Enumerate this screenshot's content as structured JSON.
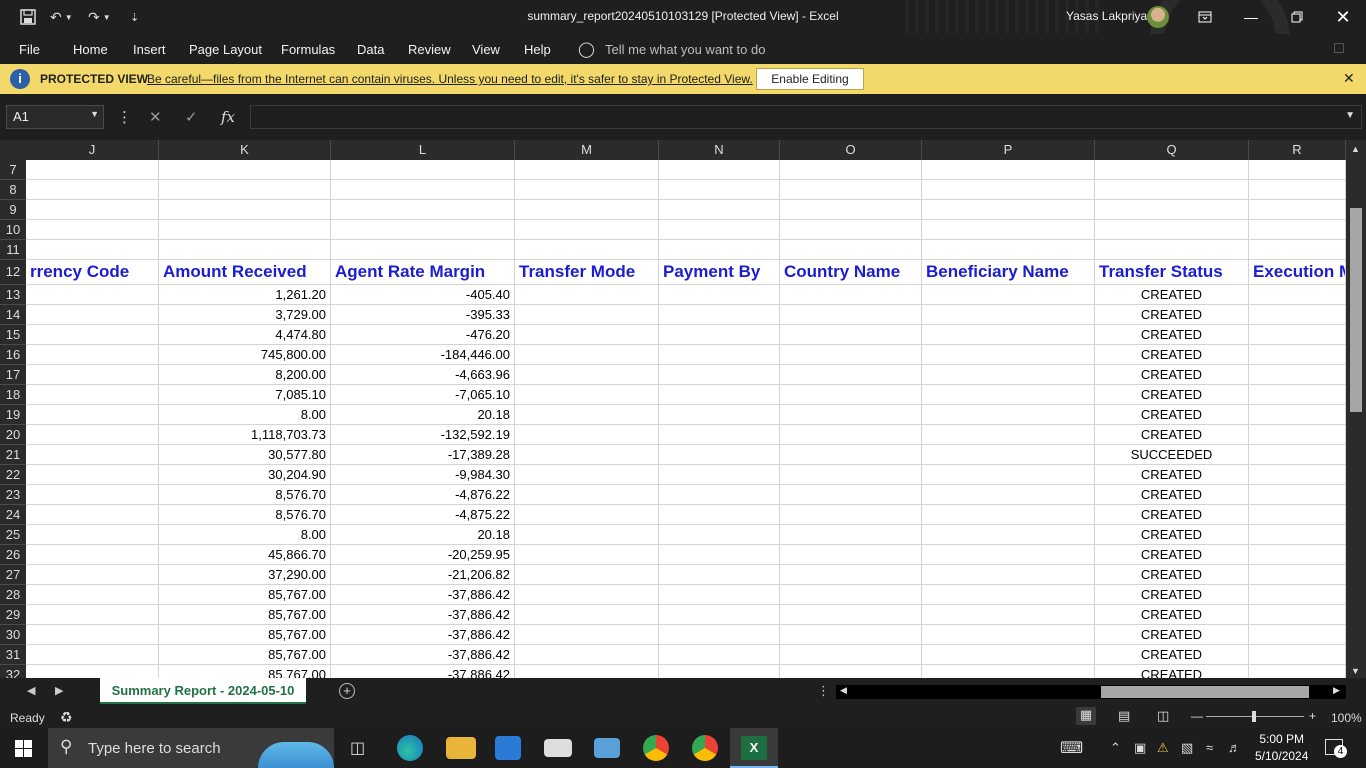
{
  "window": {
    "title": "summary_report20240510103129  [Protected View]  -  Excel",
    "user": "Yasas Lakpriya"
  },
  "menu": [
    "File",
    "Home",
    "Insert",
    "Page Layout",
    "Formulas",
    "Data",
    "Review",
    "View",
    "Help"
  ],
  "tell_me": "Tell me what you want to do",
  "protected_view": {
    "label": "PROTECTED VIEW",
    "message": "Be careful—files from the Internet can contain viruses. Unless you need to edit, it's safer to stay in Protected View.",
    "button": "Enable Editing"
  },
  "formula_bar": {
    "name_box": "A1",
    "value": ""
  },
  "columns": [
    "J",
    "K",
    "L",
    "M",
    "N",
    "O",
    "P",
    "Q",
    "R"
  ],
  "empty_rows": [
    "7",
    "8",
    "9",
    "10",
    "11"
  ],
  "header_row": {
    "num": "12",
    "cells": [
      "rrency Code",
      "Amount Received",
      "Agent Rate Margin",
      "Transfer Mode",
      "Payment By",
      "Country Name",
      "Beneficiary Name",
      "Transfer Status",
      "Execution M"
    ]
  },
  "data_rows": [
    {
      "num": "13",
      "amount": "1,261.20",
      "margin": "-405.40",
      "status": "CREATED"
    },
    {
      "num": "14",
      "amount": "3,729.00",
      "margin": "-395.33",
      "status": "CREATED"
    },
    {
      "num": "15",
      "amount": "4,474.80",
      "margin": "-476.20",
      "status": "CREATED"
    },
    {
      "num": "16",
      "amount": "745,800.00",
      "margin": "-184,446.00",
      "status": "CREATED"
    },
    {
      "num": "17",
      "amount": "8,200.00",
      "margin": "-4,663.96",
      "status": "CREATED"
    },
    {
      "num": "18",
      "amount": "7,085.10",
      "margin": "-7,065.10",
      "status": "CREATED"
    },
    {
      "num": "19",
      "amount": "8.00",
      "margin": "20.18",
      "status": "CREATED"
    },
    {
      "num": "20",
      "amount": "1,118,703.73",
      "margin": "-132,592.19",
      "status": "CREATED"
    },
    {
      "num": "21",
      "amount": "30,577.80",
      "margin": "-17,389.28",
      "status": "SUCCEEDED"
    },
    {
      "num": "22",
      "amount": "30,204.90",
      "margin": "-9,984.30",
      "status": "CREATED"
    },
    {
      "num": "23",
      "amount": "8,576.70",
      "margin": "-4,876.22",
      "status": "CREATED"
    },
    {
      "num": "24",
      "amount": "8,576.70",
      "margin": "-4,875.22",
      "status": "CREATED"
    },
    {
      "num": "25",
      "amount": "8.00",
      "margin": "20.18",
      "status": "CREATED"
    },
    {
      "num": "26",
      "amount": "45,866.70",
      "margin": "-20,259.95",
      "status": "CREATED"
    },
    {
      "num": "27",
      "amount": "37,290.00",
      "margin": "-21,206.82",
      "status": "CREATED"
    },
    {
      "num": "28",
      "amount": "85,767.00",
      "margin": "-37,886.42",
      "status": "CREATED"
    },
    {
      "num": "29",
      "amount": "85,767.00",
      "margin": "-37,886.42",
      "status": "CREATED"
    },
    {
      "num": "30",
      "amount": "85,767.00",
      "margin": "-37,886.42",
      "status": "CREATED"
    },
    {
      "num": "31",
      "amount": "85,767.00",
      "margin": "-37,886.42",
      "status": "CREATED"
    },
    {
      "num": "32",
      "amount": "85,767.00",
      "margin": "-37,886.42",
      "status": "CREATED"
    }
  ],
  "sheet_tab": "Summary Report - 2024-05-10",
  "status": {
    "ready": "Ready",
    "zoom": "100%"
  },
  "taskbar": {
    "search_placeholder": "Type here to search",
    "time": "5:00 PM",
    "date": "5/10/2024",
    "notifications": "4"
  }
}
